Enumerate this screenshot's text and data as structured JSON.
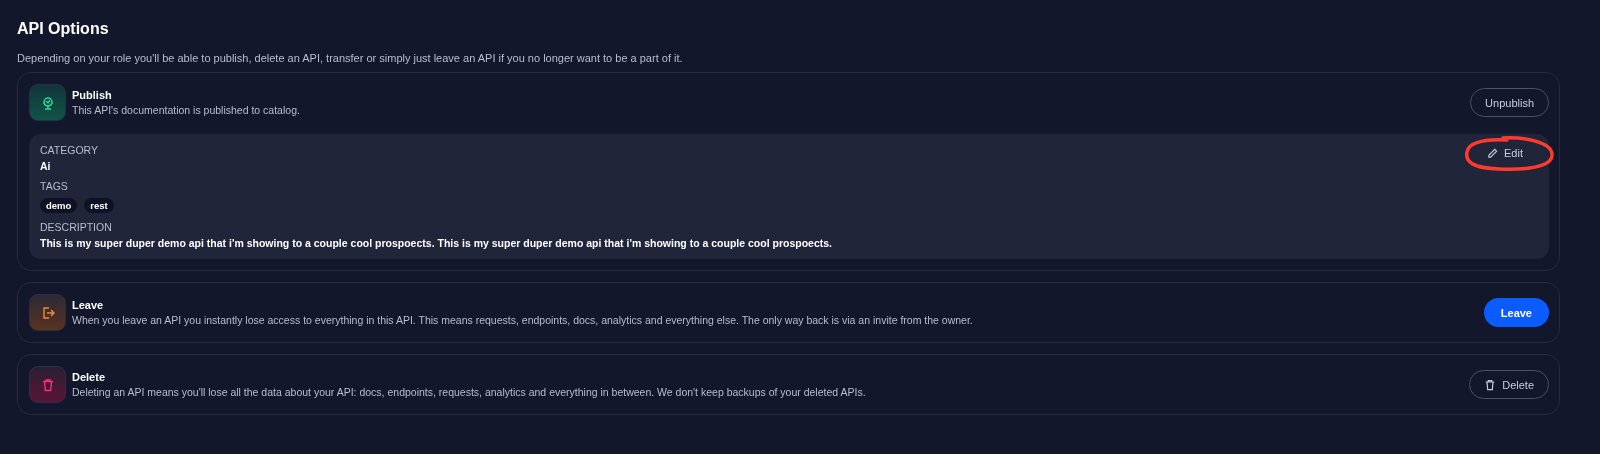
{
  "title": "API Options",
  "subtitle": "Depending on your role you'll be able to publish, delete an API, transfer or simply just leave an API if you no longer want to be a part of it.",
  "sections": [
    {
      "kind": "publish",
      "title": "Publish",
      "description": "This API's documentation is published to catalog.",
      "button": {
        "label": "Unpublish",
        "kind": "outline"
      },
      "details": {
        "edit_button": "Edit",
        "annotated": true,
        "category_label": "CATEGORY",
        "category": "Ai",
        "tags_label": "TAGS",
        "tags": [
          "demo",
          "rest"
        ],
        "description_label": "DESCRIPTION",
        "description": "This is my super duper demo api that i'm showing to a couple cool prospoects. This is my super duper demo api that i'm showing to a couple cool prospoects."
      }
    },
    {
      "kind": "leave",
      "title": "Leave",
      "description": "When you leave an API you instantly lose access to everything in this API. This means requests, endpoints, docs, analytics and everything else. The only way back is via an invite from the owner.",
      "button": {
        "label": "Leave",
        "kind": "primary"
      }
    },
    {
      "kind": "delete",
      "title": "Delete",
      "description": "Deleting an API means you'll lose all the data about your API: docs, endpoints, requests, analytics and everything in between. We don't keep backups of your deleted APIs.",
      "button": {
        "label": "Delete",
        "kind": "outline-trash"
      }
    }
  ]
}
